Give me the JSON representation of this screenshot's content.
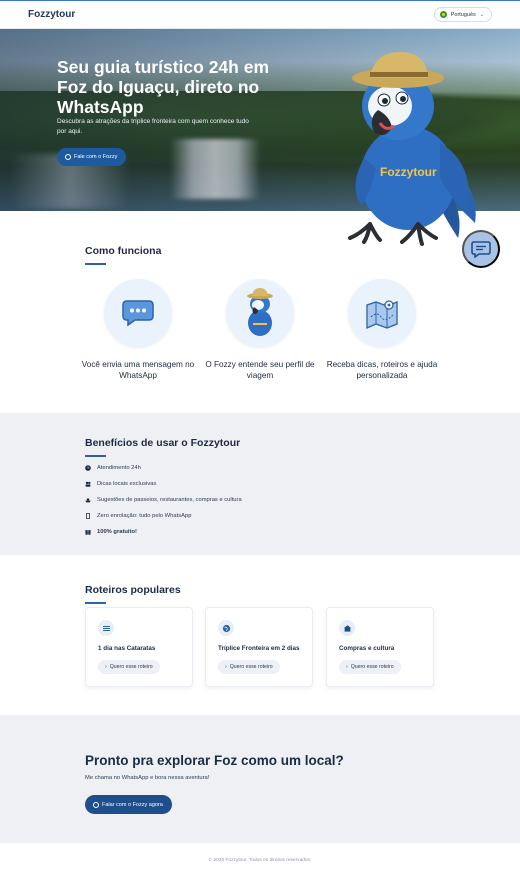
{
  "header": {
    "brand": "Fozzytour",
    "language": "Português"
  },
  "hero": {
    "title": "Seu guia turístico 24h em Foz do Iguaçu, direto no WhatsApp",
    "subtitle": "Descubra as atrações da tríplice fronteira com quem conhece tudo por aqui.",
    "button_label": "Fale com o Fozzy",
    "mascot_shirt_text": "Fozzytour"
  },
  "how": {
    "title": "Como funciona",
    "steps": [
      {
        "icon": "chat-bubble-icon",
        "text": "Você envia uma mensagem no WhatsApp"
      },
      {
        "icon": "mascot-icon",
        "text": "O Fozzy entende seu perfil de viagem"
      },
      {
        "icon": "map-icon",
        "text": "Receba dicas, roteiros e ajuda personalizada"
      }
    ]
  },
  "benefits": {
    "title": "Benefícios de usar o Fozzytour",
    "items": [
      {
        "icon": "clock-icon",
        "text": "Atendimento 24h"
      },
      {
        "icon": "people-icon",
        "text": "Dicas locais exclusivas"
      },
      {
        "icon": "ship-icon",
        "text": "Sugestões de passeios, restaurantes, compras e cultura"
      },
      {
        "icon": "phone-icon",
        "text": "Zero enrolação: tudo pelo WhatsApp"
      },
      {
        "icon": "gift-icon",
        "text": "100% gratuito!"
      }
    ]
  },
  "routes": {
    "title": "Roteiros populares",
    "cards": [
      {
        "icon": "waves-icon",
        "title": "1 dia nas Cataratas",
        "button": "Quero esse roteiro"
      },
      {
        "icon": "globe-icon",
        "title": "Tríplice Fronteira em 2 dias",
        "button": "Quero esse roteiro"
      },
      {
        "icon": "landmark-icon",
        "title": "Compras e cultura",
        "button": "Quero esse roteiro"
      }
    ]
  },
  "cta": {
    "title": "Pronto pra explorar Foz como um local?",
    "subtitle": "Me chama no WhatsApp e bora nessa aventura!",
    "button_label": "Falar com o Fozzy agora"
  },
  "footer": {
    "text": "© 2025 Fozzytour. Todos os direitos reservados."
  },
  "colors": {
    "primary": "#1e5aa0",
    "dark_text": "#1b2b44",
    "light_bg": "#eef0f3",
    "mascot_blue": "#2f6fc3"
  }
}
